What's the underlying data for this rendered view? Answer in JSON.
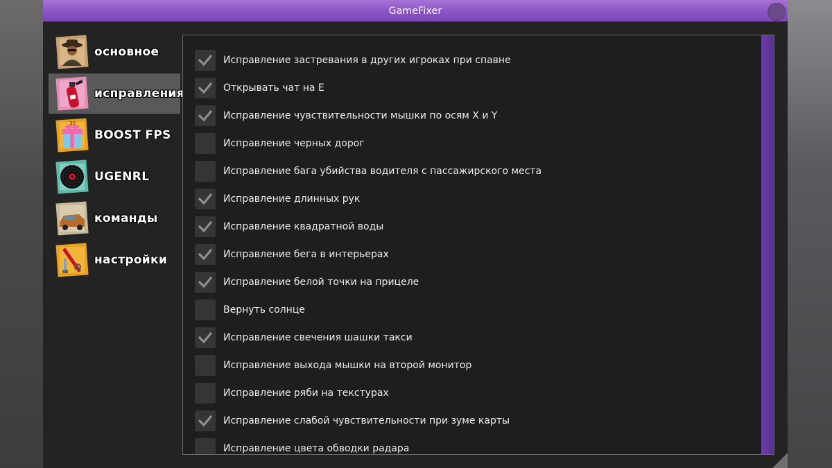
{
  "window": {
    "title": "GameFixer"
  },
  "sidebar": {
    "items": [
      {
        "label": "основное",
        "icon": "cowboy-icon",
        "active": false
      },
      {
        "label": "исправления",
        "icon": "fire-extinguisher-icon",
        "active": true
      },
      {
        "label": "BOOST FPS",
        "icon": "gift-box-icon",
        "active": false
      },
      {
        "label": "UGENRL",
        "icon": "vinyl-record-icon",
        "active": false
      },
      {
        "label": "команды",
        "icon": "car-icon",
        "active": false
      },
      {
        "label": "настройки",
        "icon": "tools-icon",
        "active": false
      }
    ]
  },
  "fixes": {
    "items": [
      {
        "label": "Исправление застревания в других игроках при спавне",
        "checked": true
      },
      {
        "label": "Открывать чат на Е",
        "checked": true
      },
      {
        "label": "Исправление чувствительности мышки по осям X и Y",
        "checked": true
      },
      {
        "label": "Исправление черных дорог",
        "checked": false
      },
      {
        "label": "Исправление бага убийства водителя с пассажирского места",
        "checked": false
      },
      {
        "label": "Исправление длинных рук",
        "checked": true
      },
      {
        "label": "Исправление квадратной воды",
        "checked": true
      },
      {
        "label": "Исправление бега в интерьерах",
        "checked": true
      },
      {
        "label": "Исправление белой точки на прицеле",
        "checked": true
      },
      {
        "label": "Вернуть солнце",
        "checked": false
      },
      {
        "label": "Исправление свечения шашки такси",
        "checked": true
      },
      {
        "label": "Исправление выхода мышки на второй монитор",
        "checked": false
      },
      {
        "label": "Исправление ряби на текстурах",
        "checked": false
      },
      {
        "label": "Исправление слабой чувствительности при зуме карты",
        "checked": true
      },
      {
        "label": "Исправление цвета обводки радара",
        "checked": false
      }
    ]
  },
  "colors": {
    "accent": "#8a54c4",
    "scrollbar": "#6b3ea6",
    "window_bg": "#232323",
    "active_nav": "#595959",
    "checkbox_bg": "#353535",
    "checkmark": "#8e8e8e"
  }
}
